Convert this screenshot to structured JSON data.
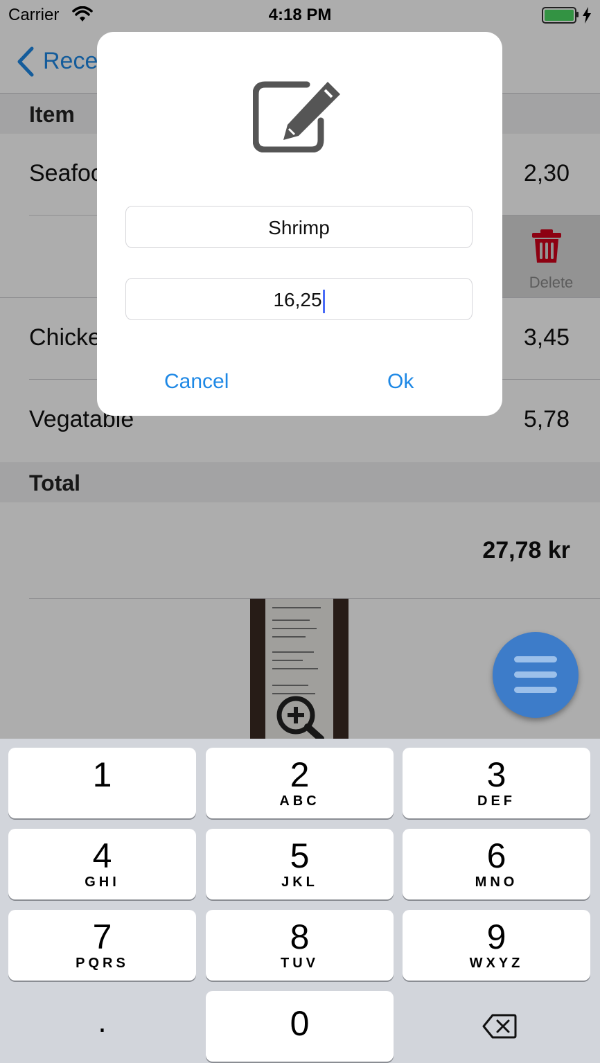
{
  "status_bar": {
    "carrier": "Carrier",
    "time": "4:18 PM"
  },
  "nav": {
    "back_label": "Rece"
  },
  "table": {
    "item_header": "Item",
    "rows": [
      {
        "name": "Seafoo",
        "price": "2,30"
      },
      {
        "name": "",
        "price": ""
      },
      {
        "name": "Chicke",
        "price": "3,45"
      },
      {
        "name": "Vegatable",
        "price": "5,78"
      }
    ],
    "delete_label": "Delete",
    "total_header": "Total",
    "total_value": "27,78 kr"
  },
  "dialog": {
    "icon": "edit-icon",
    "name_value": "Shrimp",
    "price_value": "16,25",
    "cancel_label": "Cancel",
    "ok_label": "Ok"
  },
  "keypad": {
    "keys": [
      {
        "num": "1",
        "letters": ""
      },
      {
        "num": "2",
        "letters": "ABC"
      },
      {
        "num": "3",
        "letters": "DEF"
      },
      {
        "num": "4",
        "letters": "GHI"
      },
      {
        "num": "5",
        "letters": "JKL"
      },
      {
        "num": "6",
        "letters": "MNO"
      },
      {
        "num": "7",
        "letters": "PQRS"
      },
      {
        "num": "8",
        "letters": "TUV"
      },
      {
        "num": "9",
        "letters": "WXYZ"
      },
      {
        "num": ".",
        "letters": ""
      },
      {
        "num": "0",
        "letters": ""
      },
      {
        "num": "",
        "letters": "",
        "icon": "backspace-icon"
      }
    ]
  },
  "colors": {
    "accent": "#1e88e5",
    "delete_red": "#d0021b",
    "fab_blue": "#3d7cc9",
    "battery_green": "#4cd964"
  }
}
